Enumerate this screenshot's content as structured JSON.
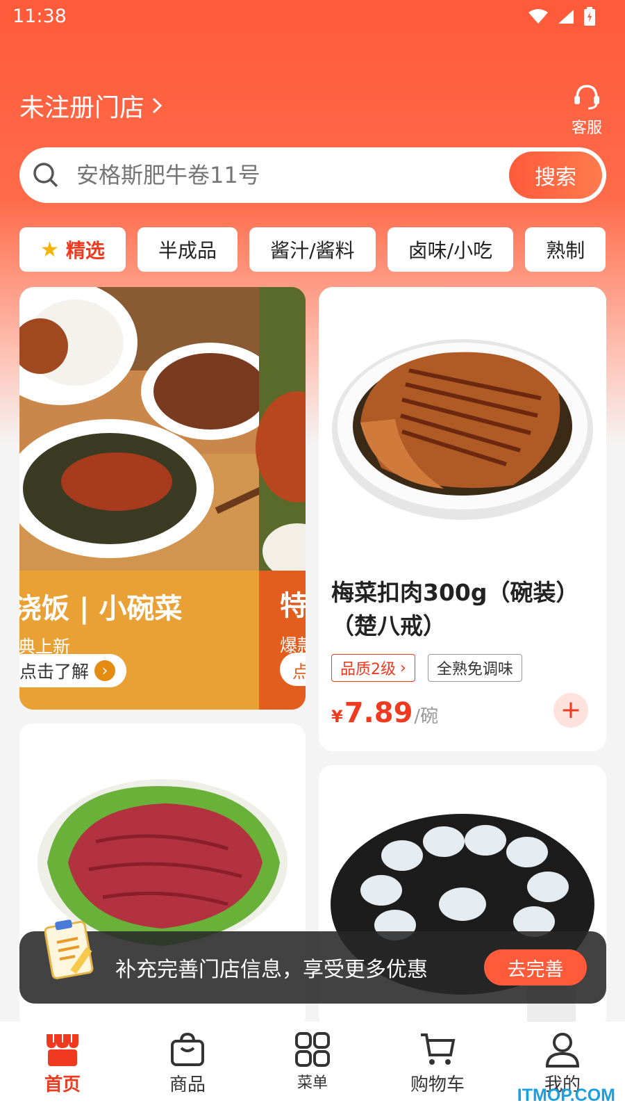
{
  "status_bar": {
    "time": "11:38"
  },
  "header": {
    "store_label": "未注册门店",
    "customer_service_label": "客服"
  },
  "search": {
    "placeholder": "安格斯肥牛卷11号",
    "button_label": "搜索"
  },
  "categories": [
    {
      "label": "精选",
      "icon": "star-icon",
      "active": true
    },
    {
      "label": "半成品"
    },
    {
      "label": "酱汁/酱料"
    },
    {
      "label": "卤味/小吃"
    },
    {
      "label": "熟制"
    }
  ],
  "banner": {
    "title": "浇饭 | 小碗菜",
    "subtitle": "典上新",
    "button_label": "点击了解",
    "side_title": "特",
    "side_subtitle": "爆款",
    "side_button": "点",
    "colors": {
      "panel": "#e9a136",
      "side": "#e35d1e"
    }
  },
  "products": [
    {
      "name": "梅菜扣肉300g（碗装）（楚八戒）",
      "tags": [
        "品质2级",
        "全熟免调味"
      ],
      "currency": "¥",
      "price": "7.89",
      "unit": "/碗"
    },
    {
      "image": "beef-slices"
    },
    {
      "image": "shrimp-platter"
    }
  ],
  "toast": {
    "text": "补充完善门店信息，享受更多优惠",
    "button_label": "去完善"
  },
  "tabbar": [
    {
      "label": "首页",
      "icon": "store-icon",
      "active": true
    },
    {
      "label": "商品",
      "icon": "bag-icon"
    },
    {
      "label": "菜单",
      "icon": "grid-icon"
    },
    {
      "label": "购物车",
      "icon": "cart-icon"
    },
    {
      "label": "我的",
      "icon": "user-icon"
    }
  ],
  "watermark": "ITMOP.COM",
  "colors": {
    "accent": "#f03a20",
    "brand_gradient_start": "#ff5a3a"
  }
}
